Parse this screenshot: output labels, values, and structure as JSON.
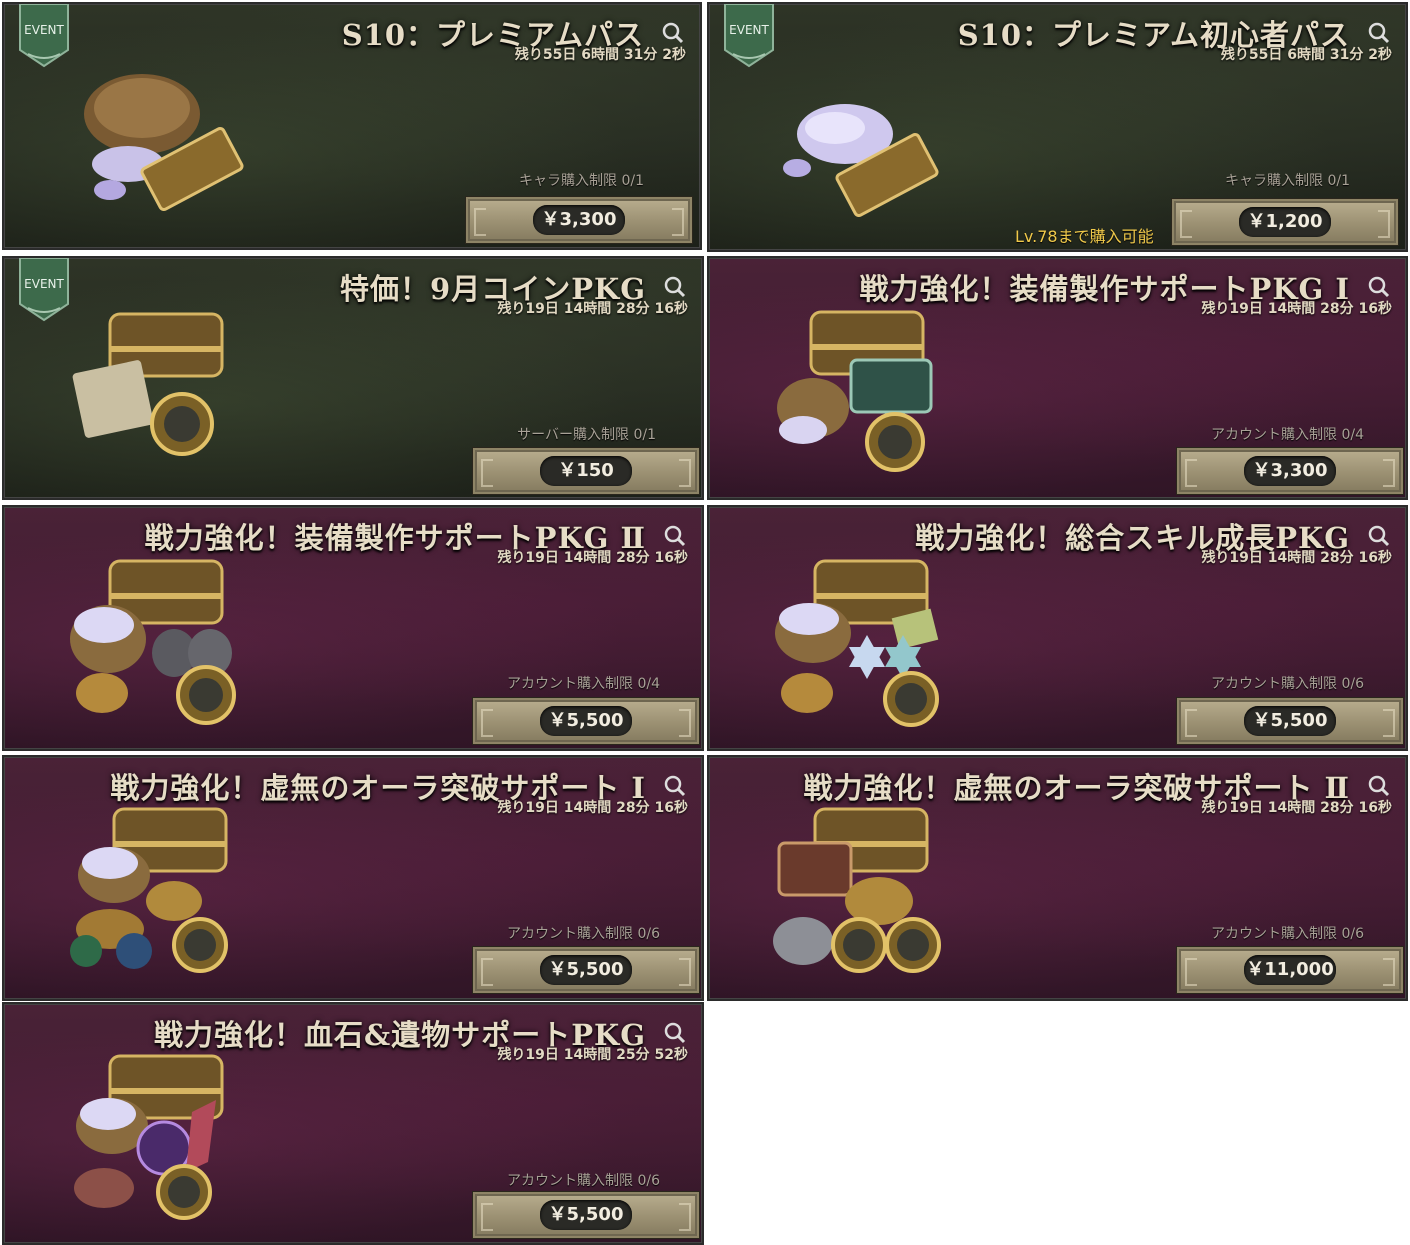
{
  "badge_text": "EVENT",
  "icons": {
    "search": "search-icon",
    "season_ticket": "season-ticket-icon",
    "coin": "coin-icon",
    "chest": "chest-icon"
  },
  "colors": {
    "title": "#e6dcc6",
    "level_requirement": "#f0c94a",
    "green_panel": "#2a3024",
    "purple_panel": "#3e1c2f"
  },
  "cards": [
    {
      "title": "S10：プレミアムパス",
      "timer": "残り55日 6時間 31分 2秒",
      "limit": "キャラ購入制限 0/1",
      "price": "￥3,300",
      "badge": "EVENT"
    },
    {
      "title": "S10：プレミアム初心者パス",
      "timer": "残り55日 6時間 31分 2秒",
      "limit": "キャラ購入制限 0/1",
      "price": "￥1,200",
      "badge": "EVENT",
      "level_req": "Lv.78まで購入可能"
    },
    {
      "title": "特価！9月コインPKG",
      "timer": "残り19日 14時間 28分 16秒",
      "limit": "サーバー購入制限 0/1",
      "price": "￥150",
      "badge": "EVENT"
    },
    {
      "title": "戦力強化！装備製作サポートPKG Ⅰ",
      "timer": "残り19日 14時間 28分 16秒",
      "limit": "アカウント購入制限 0/4",
      "price": "￥3,300"
    },
    {
      "title": "戦力強化！装備製作サポートPKG Ⅱ",
      "timer": "残り19日 14時間 28分 16秒",
      "limit": "アカウント購入制限 0/4",
      "price": "￥5,500"
    },
    {
      "title": "戦力強化！総合スキル成長PKG",
      "timer": "残り19日 14時間 28分 16秒",
      "limit": "アカウント購入制限 0/6",
      "price": "￥5,500"
    },
    {
      "title": "戦力強化！虚無のオーラ突破サポート Ⅰ",
      "timer": "残り19日 14時間 28分 16秒",
      "limit": "アカウント購入制限 0/6",
      "price": "￥5,500"
    },
    {
      "title": "戦力強化！虚無のオーラ突破サポート Ⅱ",
      "timer": "残り19日 14時間 28分 16秒",
      "limit": "アカウント購入制限 0/6",
      "price": "￥11,000"
    },
    {
      "title": "戦力強化！血石&遺物サポートPKG",
      "timer": "残り19日 14時間 25分 52秒",
      "limit": "アカウント購入制限 0/6",
      "price": "￥5,500"
    }
  ]
}
